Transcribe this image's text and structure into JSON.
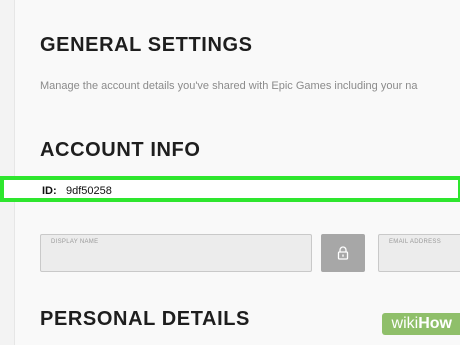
{
  "general": {
    "title": "GENERAL SETTINGS",
    "subtitle": "Manage the account details you've shared with Epic Games including your na"
  },
  "account": {
    "title": "ACCOUNT INFO",
    "id_label": "ID:",
    "id_value": "9df50258",
    "display_name_label": "DISPLAY NAME",
    "email_label": "EMAIL ADDRESS",
    "lock_icon": "lock-icon"
  },
  "personal": {
    "title": "PERSONAL DETAILS"
  },
  "watermark": {
    "part1": "wiki",
    "part2": "How"
  },
  "colors": {
    "highlight": "#2ee62e",
    "lock_button": "#a7a7a7",
    "watermark_bg": "#8fbf6a"
  }
}
